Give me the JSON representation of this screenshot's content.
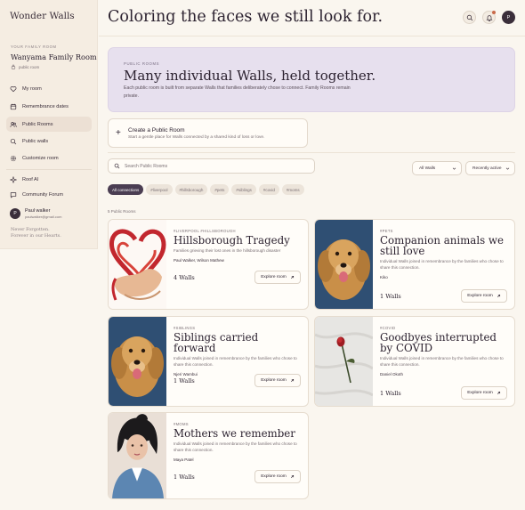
{
  "app": {
    "brand": "Wonder Walls"
  },
  "sidebar": {
    "family_label": "YOUR FAMILY ROOM",
    "family_name": "Wanyama Family Room",
    "room_type": "public room",
    "items": [
      {
        "label": "My room",
        "icon": "heart-icon"
      },
      {
        "label": "Remembrance dates",
        "icon": "calendar-icon"
      },
      {
        "label": "Public Rooms",
        "icon": "users-icon",
        "active": true
      },
      {
        "label": "Public walls",
        "icon": "search-icon"
      },
      {
        "label": "Customize room",
        "icon": "gear-icon"
      },
      {
        "label": "Roof AI",
        "icon": "sparkle-icon"
      },
      {
        "label": "Community Forum",
        "icon": "chat-icon"
      }
    ],
    "user": {
      "initial": "P",
      "name": "Paul walker",
      "email": "paulwalker@gmail.com"
    },
    "tagline_1": "Never Forgotten.",
    "tagline_2": "Forever in our Hearts."
  },
  "header": {
    "title": "Coloring the faces we still look for.",
    "avatar_initial": "P"
  },
  "hero": {
    "eyebrow": "PUBLIC ROOMS",
    "title": "Many individual Walls, held together.",
    "subtitle": "Each public room is built from separate Walls that families deliberately chose to connect. Family Rooms remain private."
  },
  "create": {
    "title": "Create a Public Room",
    "subtitle": "Start a gentle place for Walls connected by a shared kind of loss or love."
  },
  "search": {
    "placeholder": "Search Public Rooms"
  },
  "filters": {
    "walls": "All Walls",
    "sort": "Recently active"
  },
  "chips": [
    "All connections",
    "#liverpool",
    "#hillsborough",
    "#pets",
    "#siblings",
    "#covid",
    "#moms"
  ],
  "count_label": "5 Public Rooms",
  "explore_label": "Explore room",
  "cards": [
    {
      "tags": "#LIVERPOOL #HILLSBOROUGH",
      "title": "Hillsborough Tragedy",
      "desc": "Families grieving their lost ones in the hillsborough disaster",
      "people": "Paul Walker, Wilson Mathew",
      "walls": "4 Walls"
    },
    {
      "tags": "#PETS",
      "title": "Companion animals we still love",
      "desc": "Individual Walls joined in remembrance by the families who chose to share this connection.",
      "people": "Kiko",
      "walls": "1 Walls"
    },
    {
      "tags": "#SIBLINGS",
      "title": "Siblings carried forward",
      "desc": "Individual Walls joined in remembrance by the families who chose to share this connection.",
      "people": "Njeri Wambui",
      "walls": "1 Walls"
    },
    {
      "tags": "#COVID",
      "title": "Goodbyes interrupted by COVID",
      "desc": "Individual Walls joined in remembrance by the families who chose to share this connection.",
      "people": "Daniel Okoth",
      "walls": "1 Walls"
    },
    {
      "tags": "#MOMS",
      "title": "Mothers we remember",
      "desc": "Individual Walls joined in remembrance by the families who chose to share this connection.",
      "people": "Maya Patel",
      "walls": "1 Walls"
    }
  ]
}
